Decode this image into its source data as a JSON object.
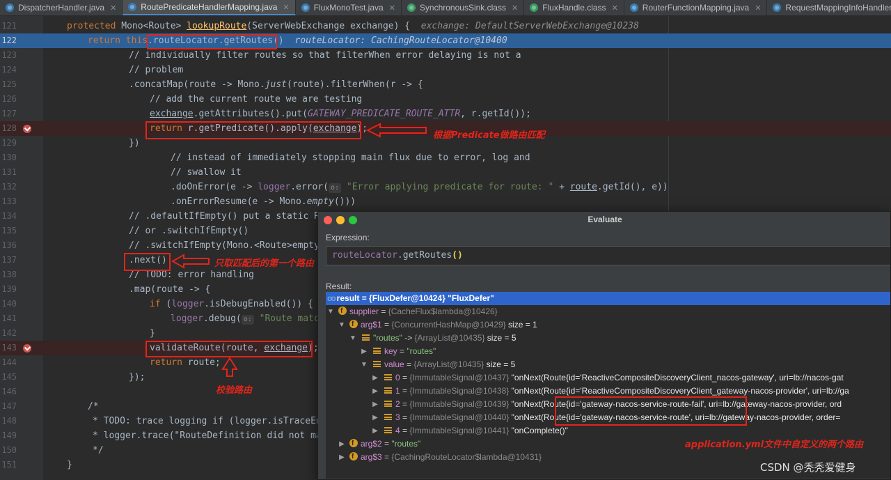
{
  "tabs": [
    {
      "label": "DispatcherHandler.java",
      "icon": "java-class-icon",
      "active": false
    },
    {
      "label": "RoutePredicateHandlerMapping.java",
      "icon": "java-class-icon",
      "active": true
    },
    {
      "label": "FluxMonoTest.java",
      "icon": "java-class-icon",
      "active": false
    },
    {
      "label": "SynchronousSink.class",
      "icon": "compiled-class-icon",
      "active": false
    },
    {
      "label": "FluxHandle.class",
      "icon": "compiled-class-icon",
      "active": false
    },
    {
      "label": "RouterFunctionMapping.java",
      "icon": "java-class-icon",
      "active": false
    },
    {
      "label": "RequestMappingInfoHandlerMapping.java",
      "icon": "java-class-icon",
      "active": false
    }
  ],
  "code": {
    "l121": {
      "num": "121",
      "kw": "protected",
      "type": " Mono<Route> ",
      "fn": "lookupRoute",
      "rest": "(ServerWebExchange exchange) {",
      "inlay": "exchange: DefaultServerWebExchange@10238"
    },
    "l122": {
      "num": "122",
      "kw": "return this",
      "dot": ".",
      "call": "routeLocator.getRoutes()",
      "inlay": "routeLocator: CachingRouteLocator@10400"
    },
    "l123": {
      "num": "123",
      "text": "// individually filter routes so that filterWhen error delaying is not a"
    },
    "l124": {
      "num": "124",
      "text": "// problem"
    },
    "l125": {
      "num": "125",
      "a": ".concatMap(route -> Mono.",
      "b": "just",
      "c": "(route).filterWhen(r -> {"
    },
    "l126": {
      "num": "126",
      "text": "// add the current route we are testing"
    },
    "l127": {
      "num": "127",
      "a": "exchange",
      "b": ".getAttributes().put(",
      "c": "GATEWAY_PREDICATE_ROUTE_ATTR",
      "d": ", r.getId());"
    },
    "l128": {
      "num": "128",
      "kw": "return",
      "a": " r.getPredicate().apply(",
      "b": "exchange",
      "c": ");"
    },
    "l129": {
      "num": "129",
      "text": "})"
    },
    "l130": {
      "num": "130",
      "text": "// instead of immediately stopping main flux due to error, log and"
    },
    "l131": {
      "num": "131",
      "text": "// swallow it"
    },
    "l132": {
      "num": "132",
      "a": ".doOnError(e -> ",
      "b": "logger",
      "c": ".error(",
      "hint": "o:",
      "d": "\"Error applying predicate for route: \"",
      "e": " + ",
      "f": "route",
      "g": ".getId(), e))"
    },
    "l133": {
      "num": "133",
      "a": ".onErrorResume(e -> Mono.",
      "b": "empty",
      "c": "()))"
    },
    "l134": {
      "num": "134",
      "text": "// .defaultIfEmpty() put a static Ro"
    },
    "l135": {
      "num": "135",
      "text": "// or .switchIfEmpty()"
    },
    "l136": {
      "num": "136",
      "text": "// .switchIfEmpty(Mono.<Route>empty("
    },
    "l137": {
      "num": "137",
      "text": ".next()"
    },
    "l138": {
      "num": "138",
      "text": "// TODO: error handling"
    },
    "l139": {
      "num": "139",
      "text": ".map(route -> {"
    },
    "l140": {
      "num": "140",
      "kw": "if",
      "a": " (",
      "b": "logger",
      "c": ".isDebugEnabled()) {"
    },
    "l141": {
      "num": "141",
      "a": "logger",
      "b": ".debug(",
      "hint": "o:",
      "c": "\"Route match"
    },
    "l142": {
      "num": "142",
      "text": "}"
    },
    "l143": {
      "num": "143",
      "a": "validateRoute(route, ",
      "b": "exchange",
      "c": ");"
    },
    "l144": {
      "num": "144",
      "kw": "return",
      "a": " route;"
    },
    "l145": {
      "num": "145",
      "text": "});"
    },
    "l146": {
      "num": "146",
      "text": ""
    },
    "l147": {
      "num": "147",
      "text": "/*"
    },
    "l148": {
      "num": "148",
      "text": "* TODO: trace logging if (logger.isTraceEna"
    },
    "l149": {
      "num": "149",
      "text": "* logger.trace(\"RouteDefinition did not mat"
    },
    "l150": {
      "num": "150",
      "text": "*/"
    },
    "l151": {
      "num": "151",
      "text": "}"
    }
  },
  "annotations": {
    "predicate_match": "根据Predicate做路由匹配",
    "first_route": "只取匹配后的第一个路由",
    "validate_route": "校验路由",
    "yml_routes": "application.yml文件中自定义的两个路由"
  },
  "evaluate": {
    "title": "Evaluate",
    "expression_label": "Expression:",
    "expression_obj": "routeLocator",
    "expression_call": ".getRoutes",
    "expression_parens": "()",
    "result_label": "Result:",
    "rows": [
      {
        "name": "result",
        "sep": " = ",
        "value": "{FluxDefer@10424} \"FluxDefer\""
      },
      {
        "name": "supplier",
        "sep": " = ",
        "type": "{CacheFlux$lambda@10426}"
      },
      {
        "name": "arg$1",
        "sep": " = ",
        "type": "{ConcurrentHashMap@10429}",
        "extra": " size = 1"
      },
      {
        "name": "\"routes\"",
        "sep": " -> ",
        "type": "{ArrayList@10435}",
        "extra": " size = 5"
      },
      {
        "name": "key",
        "sep": " = ",
        "value": "\"routes\""
      },
      {
        "name": "value",
        "sep": " = ",
        "type": "{ArrayList@10435}",
        "extra": " size = 5"
      },
      {
        "name": "0",
        "sep": " = ",
        "type": "{ImmutableSignal@10437}",
        "extra": " \"onNext(Route{id='ReactiveCompositeDiscoveryClient_nacos-gateway', uri=lb://nacos-gat"
      },
      {
        "name": "1",
        "sep": " = ",
        "type": "{ImmutableSignal@10438}",
        "extra": " \"onNext(Route{id='ReactiveCompositeDiscoveryClient_gateway-nacos-provider', uri=lb://ga"
      },
      {
        "name": "2",
        "sep": " = ",
        "type": "{ImmutableSignal@10439}",
        "extra": " \"onNext(Route{id='gateway-nacos-service-route-fail', uri=lb://gateway-nacos-provider, ord"
      },
      {
        "name": "3",
        "sep": " = ",
        "type": "{ImmutableSignal@10440}",
        "extra": " \"onNext(Route{id='gateway-nacos-service-route', uri=lb://gateway-nacos-provider, order="
      },
      {
        "name": "4",
        "sep": " = ",
        "type": "{ImmutableSignal@10441}",
        "extra": " \"onComplete()\""
      },
      {
        "name": "arg$2",
        "sep": " = ",
        "value": "\"routes\""
      },
      {
        "name": "arg$3",
        "sep": " = ",
        "type": "{CachingRouteLocator$lambda@10431}"
      }
    ]
  },
  "watermark": "CSDN @秃秃爱健身",
  "colors": {
    "accent": "#e1251b",
    "exec_line": "#2d6099",
    "selection": "#2f65ca",
    "breakpoint": "#c75450"
  }
}
